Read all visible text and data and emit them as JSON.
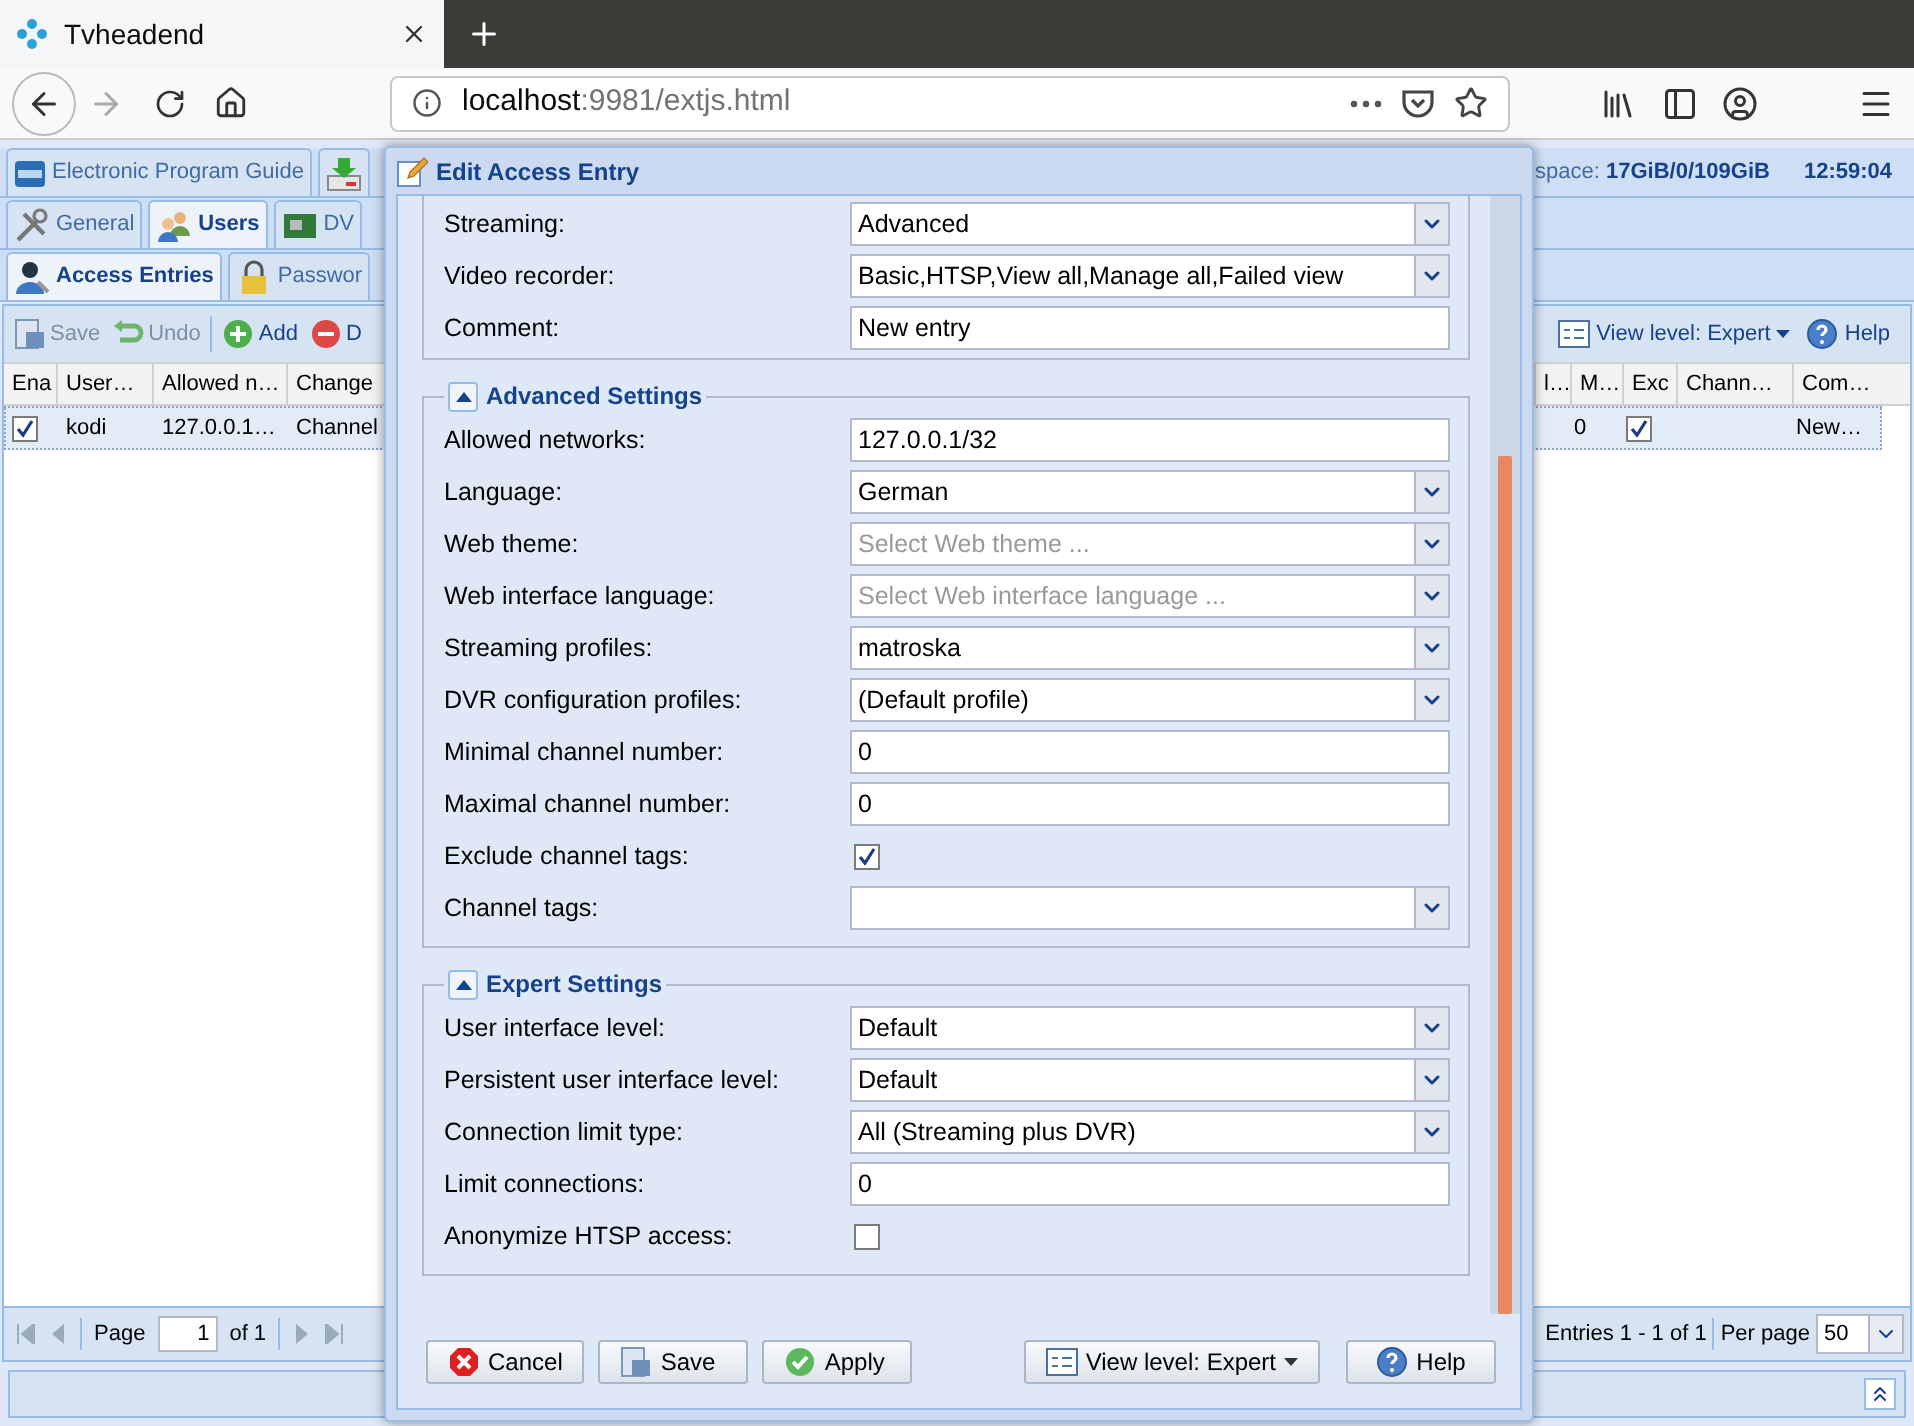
{
  "browser": {
    "tab_title": "Tvheadend",
    "url_host": "localhost",
    "url_path": ":9981/extjs.html"
  },
  "app": {
    "top_tabs": [
      {
        "label": "Electronic Program Guide",
        "kind": "epg",
        "selected": false
      },
      {
        "kind": "download",
        "selected": false
      }
    ],
    "status": {
      "space_label": "space:",
      "space_value": "17GiB/0/109GiB",
      "time": "12:59:04"
    },
    "sub_tabs": [
      {
        "label": "General",
        "kind": "tools",
        "selected": false
      },
      {
        "label": "Users",
        "kind": "users",
        "selected": true
      },
      {
        "label": "DV",
        "kind": "card",
        "selected": false
      }
    ],
    "user_tabs": [
      {
        "label": "Access Entries",
        "kind": "user",
        "selected": true
      },
      {
        "label": "Passwor",
        "kind": "lock",
        "selected": false
      }
    ],
    "toolbar": [
      {
        "label": "Save",
        "kind": "save",
        "disabled": true
      },
      {
        "label": "Undo",
        "kind": "undo",
        "disabled": true
      },
      {
        "label": "Add",
        "kind": "add",
        "disabled": false
      },
      {
        "label": "D",
        "kind": "delete",
        "disabled": false
      }
    ],
    "toolbar_right": [
      {
        "label": "View level: Expert",
        "kind": "view"
      },
      {
        "label": "Help",
        "kind": "help"
      }
    ],
    "grid": {
      "left_columns": [
        "Ena",
        "User…",
        "Allowed n…",
        "Change"
      ],
      "right_columns": [
        "l…",
        "M…",
        "Exc",
        "Chann…",
        "Com…"
      ],
      "rows": [
        {
          "selected": true,
          "left_cells": [
            {
              "kind": "check",
              "checked": true
            },
            {
              "kind": "text",
              "text": "kodi"
            },
            {
              "kind": "text",
              "text": "127.0.0.1…"
            },
            {
              "kind": "text",
              "text": "Channel"
            }
          ],
          "right_cells": [
            {
              "kind": "blank"
            },
            {
              "kind": "text",
              "text": "0"
            },
            {
              "kind": "check",
              "checked": true
            },
            {
              "kind": "blank"
            },
            {
              "kind": "text",
              "text": "New…"
            }
          ]
        }
      ]
    },
    "paging": {
      "page_label": "Page",
      "page": "1",
      "of": "of 1",
      "entries": "Entries 1 - 1 of 1",
      "per_page_label": "Per page",
      "per_page": "50"
    }
  },
  "dialog": {
    "title": "Edit Access Entry",
    "sections": [
      {
        "fields": [
          {
            "label": "Streaming:",
            "kind": "combo",
            "value": "Advanced"
          },
          {
            "label": "Video recorder:",
            "kind": "combo",
            "value": "Basic,HTSP,View all,Manage all,Failed view"
          },
          {
            "label": "Comment:",
            "kind": "text",
            "value": "New entry"
          }
        ]
      },
      {
        "title": "Advanced Settings",
        "expanded": true,
        "fields": [
          {
            "label": "Allowed networks:",
            "kind": "text",
            "value": "127.0.0.1/32"
          },
          {
            "label": "Language:",
            "kind": "combo",
            "value": "German"
          },
          {
            "label": "Web theme:",
            "kind": "combo",
            "placeholder": "Select Web theme ..."
          },
          {
            "label": "Web interface language:",
            "kind": "combo",
            "placeholder": "Select Web interface language ..."
          },
          {
            "label": "Streaming profiles:",
            "kind": "combo",
            "value": "matroska"
          },
          {
            "label": "DVR configuration profiles:",
            "kind": "combo",
            "value": "(Default profile)"
          },
          {
            "label": "Minimal channel number:",
            "kind": "text",
            "value": "0"
          },
          {
            "label": "Maximal channel number:",
            "kind": "text",
            "value": "0"
          },
          {
            "label": "Exclude channel tags:",
            "kind": "checkbox",
            "checked": true
          },
          {
            "label": "Channel tags:",
            "kind": "combo"
          }
        ]
      },
      {
        "title": "Expert Settings",
        "expanded": true,
        "fields": [
          {
            "label": "User interface level:",
            "kind": "combo",
            "value": "Default"
          },
          {
            "label": "Persistent user interface level:",
            "kind": "combo",
            "value": "Default"
          },
          {
            "label": "Connection limit type:",
            "kind": "combo",
            "value": "All (Streaming plus DVR)"
          },
          {
            "label": "Limit connections:",
            "kind": "text",
            "value": "0"
          },
          {
            "label": "Anonymize HTSP access:",
            "kind": "checkbox",
            "checked": false
          }
        ]
      }
    ],
    "buttons": [
      {
        "label": "Cancel",
        "kind": "cancel"
      },
      {
        "label": "Save",
        "kind": "save"
      },
      {
        "label": "Apply",
        "kind": "apply"
      },
      {
        "label": "View level: Expert",
        "kind": "view"
      },
      {
        "label": "Help",
        "kind": "help"
      }
    ]
  }
}
